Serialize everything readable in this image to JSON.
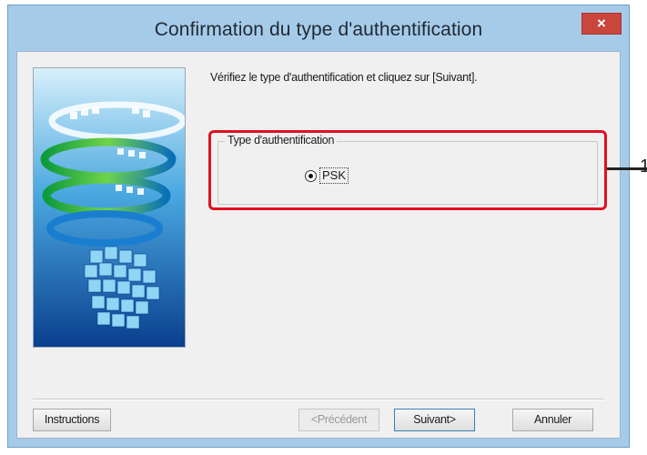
{
  "window": {
    "title": "Confirmation du type d'authentification",
    "close_label": "×"
  },
  "content": {
    "instruction": "Vérifiez le type d'authentification et cliquez sur [Suivant].",
    "group_label": "Type d'authentification",
    "option_label": "PSK",
    "option_selected": true
  },
  "buttons": {
    "instructions": "Instructions",
    "previous": "<Précédent",
    "next": "Suivant>",
    "cancel": "Annuler"
  },
  "annotation": {
    "number": "1",
    "color": "#e01020"
  },
  "icons": {
    "close": "close-icon",
    "radio": "radio-selected-icon"
  }
}
